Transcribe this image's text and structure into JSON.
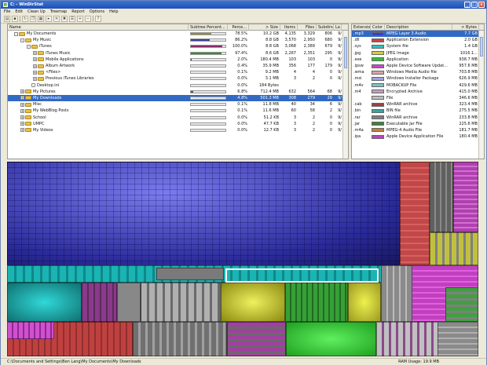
{
  "window": {
    "title": "C: - WinDirStat",
    "min": "_",
    "max": "□",
    "close": "x"
  },
  "menu": [
    "File",
    "Edit",
    "Clean Up",
    "Treemap",
    "Report",
    "Options",
    "Help"
  ],
  "toolbar_icons": [
    "open-icon",
    "save-icon",
    "sep",
    "refresh-icon",
    "copy-icon",
    "explorer-icon",
    "command-icon",
    "delete-icon",
    "delete-x-icon",
    "properties-icon",
    "zoom-in-icon",
    "zoom-out-icon",
    "sep",
    "help-icon"
  ],
  "tree": {
    "columns": [
      "Name",
      "Subtree Percent...",
      "Perce...",
      "> Size",
      "Items",
      "Files",
      "Subdirs",
      "La"
    ],
    "rows": [
      {
        "name": "My Documents",
        "indent": 1,
        "pm": "-",
        "bar": 0.58,
        "bar_color": "#8f8f3a",
        "pct": "78.5%",
        "size": "10.2 GB",
        "items": "4,135",
        "files": "3,329",
        "subdirs": "806",
        "la": "9/"
      },
      {
        "name": "My Music",
        "indent": 2,
        "pm": "-",
        "bar": 0.55,
        "bar_color": "#3b3b9c",
        "pct": "86.2%",
        "size": "8.8 GB",
        "items": "3,570",
        "files": "2,950",
        "subdirs": "680",
        "la": "9/"
      },
      {
        "name": "iTunes",
        "indent": 3,
        "pm": "-",
        "bar": 0.9,
        "bar_color": "#8a2a6a",
        "pct": "100.0%",
        "size": "8.8 GB",
        "items": "3,068",
        "files": "2,389",
        "subdirs": "679",
        "la": "9/"
      },
      {
        "name": "iTunes Music",
        "indent": 4,
        "pm": "+",
        "bar": 0.88,
        "bar_color": "#2f8f2f",
        "pct": "97.4%",
        "size": "8.6 GB",
        "items": "2,267",
        "files": "2,351",
        "subdirs": "295",
        "la": "9/"
      },
      {
        "name": "Mobile Applications",
        "indent": 4,
        "pm": "+",
        "bar": 0.02,
        "bar_color": "#3b3b9c",
        "pct": "2.0%",
        "size": "180.4 MB",
        "items": "103",
        "files": "103",
        "subdirs": "0",
        "la": "9/"
      },
      {
        "name": "Album Artwork",
        "indent": 4,
        "pm": "+",
        "bar": 0.0,
        "bar_color": "#3b3b9c",
        "pct": "0.4%",
        "size": "35.9 MB",
        "items": "356",
        "files": "177",
        "subdirs": "179",
        "la": "9/"
      },
      {
        "name": "<Files>",
        "indent": 4,
        "pm": "+",
        "bar": 0.0,
        "bar_color": "#3b3b9c",
        "pct": "0.1%",
        "size": "9.2 MB",
        "items": "4",
        "files": "4",
        "subdirs": "0",
        "la": "9/"
      },
      {
        "name": "Previous iTunes Libraries",
        "indent": 4,
        "pm": "+",
        "bar": 0.0,
        "bar_color": "#3b3b9c",
        "pct": "0.0%",
        "size": "3.1 MB",
        "items": "3",
        "files": "2",
        "subdirs": "0",
        "la": "9/"
      },
      {
        "name": "Desktop.ini",
        "indent": 3,
        "pm": "",
        "bar": 0.0,
        "bar_color": "#3b3b9c",
        "pct": "0.0%",
        "size": "184 Bytes",
        "items": "",
        "files": "",
        "subdirs": "",
        "la": ""
      },
      {
        "name": "My Pictures",
        "indent": 2,
        "pm": "+",
        "bar": 0.07,
        "bar_color": "#555",
        "pct": "6.8%",
        "size": "712.4 MB",
        "items": "632",
        "files": "564",
        "subdirs": "68",
        "la": "9/"
      },
      {
        "name": "My Downloads",
        "indent": 2,
        "pm": "+",
        "bar": 0.04,
        "bar_color": "#fff",
        "pct": "4.8%",
        "size": "501.3 MB",
        "items": "308",
        "files": "279",
        "subdirs": "29",
        "la": "9/",
        "selected": true
      },
      {
        "name": "Misc",
        "indent": 2,
        "pm": "+",
        "bar": 0.0,
        "bar_color": "#555",
        "pct": "0.1%",
        "size": "11.8 MB",
        "items": "40",
        "files": "34",
        "subdirs": "6",
        "la": "9/"
      },
      {
        "name": "My WebBlog Posts",
        "indent": 2,
        "pm": "+",
        "bar": 0.0,
        "bar_color": "#555",
        "pct": "0.1%",
        "size": "11.6 MB",
        "items": "60",
        "files": "58",
        "subdirs": "2",
        "la": "9/"
      },
      {
        "name": "School",
        "indent": 2,
        "pm": "+",
        "bar": 0.0,
        "bar_color": "#555",
        "pct": "0.0%",
        "size": "51.2 KB",
        "items": "3",
        "files": "2",
        "subdirs": "0",
        "la": "9/"
      },
      {
        "name": "UMPC",
        "indent": 2,
        "pm": "+",
        "bar": 0.0,
        "bar_color": "#555",
        "pct": "0.0%",
        "size": "47.7 KB",
        "items": "3",
        "files": "2",
        "subdirs": "0",
        "la": "9/"
      },
      {
        "name": "My Videos",
        "indent": 2,
        "pm": "+",
        "bar": 0.0,
        "bar_color": "#555",
        "pct": "0.0%",
        "size": "12.7 KB",
        "items": "3",
        "files": "2",
        "subdirs": "0",
        "la": "9/"
      }
    ]
  },
  "extensions": {
    "columns": [
      "Extension",
      "Color",
      "Description",
      "> Bytes"
    ],
    "rows": [
      {
        "ext": ".mp3",
        "color": "#3b3bd0",
        "desc": "MPEG Layer 3 Audio",
        "bytes": "7.7 GB",
        "selected": true
      },
      {
        "ext": ".dll",
        "color": "#d04040",
        "desc": "Application Extension",
        "bytes": "2.0 GB"
      },
      {
        "ext": ".sys",
        "color": "#2fc0c0",
        "desc": "System file",
        "bytes": "1.4 GB"
      },
      {
        "ext": ".jpg",
        "color": "#d0d040",
        "desc": "JPEG Image",
        "bytes": "1016.1..."
      },
      {
        "ext": ".exe",
        "color": "#30c030",
        "desc": "Application",
        "bytes": "938.7 MB"
      },
      {
        "ext": ".ipsw",
        "color": "#d040d0",
        "desc": "Apple Device Software Updat...",
        "bytes": "957.6 MB"
      },
      {
        "ext": ".wma",
        "color": "#e0a0a0",
        "desc": "Windows Media Audio file",
        "bytes": "703.8 MB"
      },
      {
        "ext": ".msi",
        "color": "#a0a0e0",
        "desc": "Windows Installer Package",
        "bytes": "626.9 MB"
      },
      {
        "ext": ".m4v",
        "color": "#80c0c0",
        "desc": "MOBACKUP File",
        "bytes": "429.6 MB"
      },
      {
        "ext": ".m4",
        "color": "#c0a0c0",
        "desc": "Encrypted Archive",
        "bytes": "415.0 MB"
      },
      {
        "ext": "",
        "color": "#c0c0c0",
        "desc": "File",
        "bytes": "346.6 MB"
      },
      {
        "ext": ".cab",
        "color": "#a04040",
        "desc": "WinRAR archive",
        "bytes": "323.4 MB"
      },
      {
        "ext": ".bin",
        "color": "#40a0a0",
        "desc": "BIN file",
        "bytes": "275.5 MB"
      },
      {
        "ext": ".rar",
        "color": "#808080",
        "desc": "WinRAR archive",
        "bytes": "233.8 MB"
      },
      {
        "ext": ".jar",
        "color": "#408040",
        "desc": "Executable Jar File",
        "bytes": "225.6 MB"
      },
      {
        "ext": ".m4a",
        "color": "#c08040",
        "desc": "MPEG-4 Audio File",
        "bytes": "181.7 MB"
      },
      {
        "ext": ".ipa",
        "color": "#c040c0",
        "desc": "Apple Device Application File",
        "bytes": "180.4 MB"
      }
    ]
  },
  "status": {
    "path": "C:\\Documents and Settings\\Ben Lang\\My Documents\\My Downloads",
    "ram": "RAM Usage:",
    "ram_value": "19.9 MB"
  }
}
